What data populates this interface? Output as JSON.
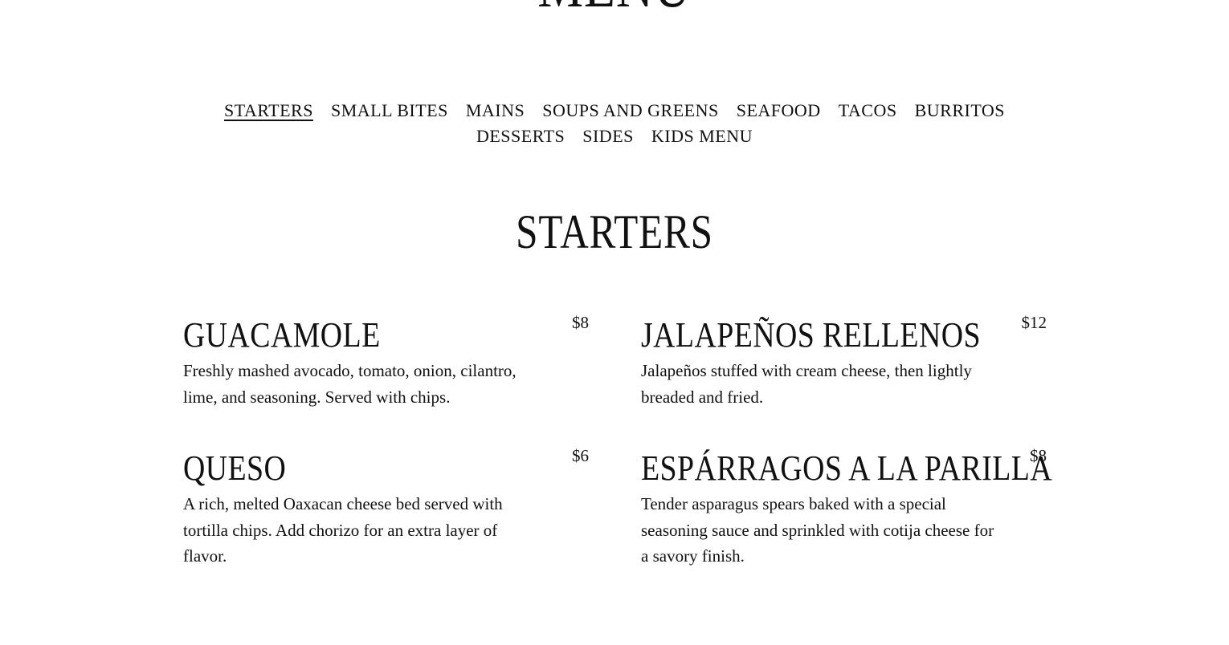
{
  "page": {
    "heading": "MENU"
  },
  "nav": {
    "items": [
      {
        "label": "STARTERS",
        "active": true
      },
      {
        "label": "SMALL BITES",
        "active": false
      },
      {
        "label": "MAINS",
        "active": false
      },
      {
        "label": "SOUPS AND GREENS",
        "active": false
      },
      {
        "label": "SEAFOOD",
        "active": false
      },
      {
        "label": "TACOS",
        "active": false
      },
      {
        "label": "BURRITOS",
        "active": false
      },
      {
        "label": "DESSERTS",
        "active": false
      },
      {
        "label": "SIDES",
        "active": false
      },
      {
        "label": "KIDS MENU",
        "active": false
      }
    ]
  },
  "section": {
    "title": "STARTERS",
    "items": [
      {
        "name": "GUACAMOLE",
        "price": "$8",
        "description": "Freshly mashed avocado, tomato, onion, cilantro, lime, and seasoning. Served with chips."
      },
      {
        "name": "JALAPEÑOS RELLENOS",
        "price": "$12",
        "description": "Jalapeños stuffed with cream cheese, then lightly breaded and fried."
      },
      {
        "name": "QUESO",
        "price": "$6",
        "description": "A rich, melted Oaxacan cheese bed served with tortilla chips. Add chorizo for an extra layer of flavor."
      },
      {
        "name": "ESPÁRRAGOS A LA PARILLA",
        "price": "$8",
        "description": "Tender asparagus spears baked with a special seasoning sauce and sprinkled with cotija cheese for a savory finish."
      }
    ]
  }
}
